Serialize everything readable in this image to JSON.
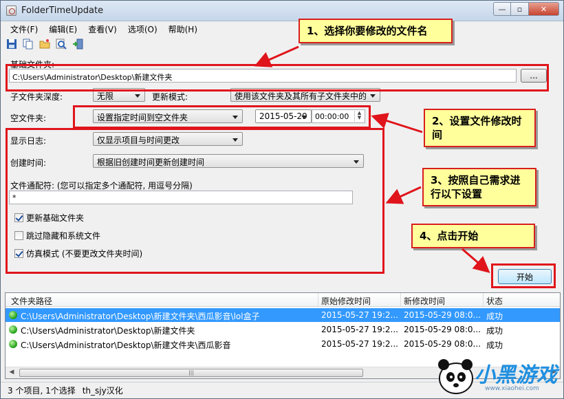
{
  "window": {
    "title": "FolderTimeUpdate",
    "min_glyph": "—",
    "max_glyph": "▫",
    "close_glyph": "✕"
  },
  "menu": [
    "文件(F)",
    "编辑(E)",
    "查看(V)",
    "选项(O)",
    "帮助(H)"
  ],
  "toolbar": [
    "save-icon",
    "copy-icon",
    "folder-open-icon",
    "find-icon",
    "exit-icon"
  ],
  "base_folder": {
    "label": "基础文件夹:",
    "value": "C:\\Users\\Administrator\\Desktop\\新建文件夹",
    "browse_label": "..."
  },
  "subfolder": {
    "label": "子文件夹深度:",
    "value": "无限",
    "update_mode_label": "更新模式:",
    "update_mode_value": "使用该文件夹及其所有子文件夹中的"
  },
  "empty_folder": {
    "label": "空文件夹:",
    "value": "设置指定时间到空文件夹",
    "date": "2015-05-29",
    "time": "00:00:00"
  },
  "log": {
    "label": "显示日志:",
    "value": "仅显示项目与时间更改"
  },
  "created": {
    "label": "创建时间:",
    "value": "根据旧创建时间更新创建时间"
  },
  "wildcard": {
    "label": "文件通配符: (您可以指定多个通配符, 用逗号分隔)",
    "value": "*"
  },
  "options": [
    {
      "label": "更新基础文件夹",
      "checked": true
    },
    {
      "label": "跳过隐藏和系统文件",
      "checked": false
    },
    {
      "label": "仿真模式 (不要更改文件夹时间)",
      "checked": true
    }
  ],
  "start_label": "开始",
  "callouts": {
    "c1": "1、选择你要修改的文件名",
    "c2": "2、设置文件修改时间",
    "c3": "3、按照自己需求进行以下设置",
    "c4": "4、点击开始"
  },
  "table": {
    "columns": [
      "文件夹路径",
      "原始修改时间",
      "新修改时间",
      "状态"
    ],
    "rows": [
      {
        "path": "C:\\Users\\Administrator\\Desktop\\新建文件夹\\西瓜影音\\lol盒子",
        "orig": "2015-05-27 19:2...",
        "new": "2015-05-29 08:0...",
        "status": "成功",
        "selected": true
      },
      {
        "path": "C:\\Users\\Administrator\\Desktop\\新建文件夹",
        "orig": "2015-05-27 19:2...",
        "new": "2015-05-29 08:0...",
        "status": "成功",
        "selected": false
      },
      {
        "path": "C:\\Users\\Administrator\\Desktop\\新建文件夹\\西瓜影音",
        "orig": "2015-05-27 19:2...",
        "new": "2015-05-29 08:0...",
        "status": "成功",
        "selected": false
      }
    ]
  },
  "status": {
    "count": "3 个项目, 1个选择",
    "credit": "th_sjy汉化"
  },
  "watermark": {
    "brand": "小黑游戏",
    "url": "www.xiaohei.com"
  },
  "colors": {
    "annotation_red": "#e0141b",
    "callout_bg": "#ffff9c",
    "selection": "#3399ff",
    "brand_blue": "#1f8fe0"
  }
}
